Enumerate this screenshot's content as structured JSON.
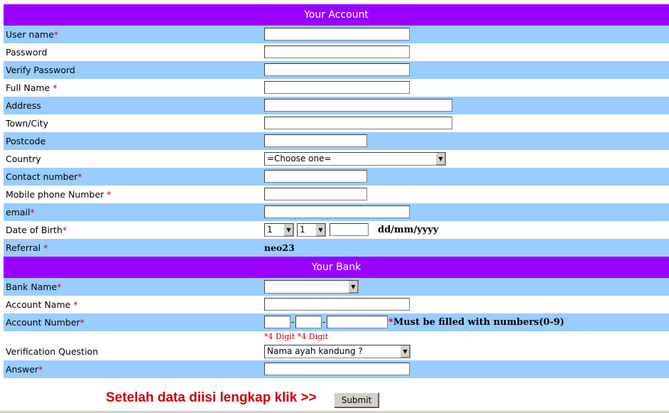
{
  "account_section": {
    "title": "Your Account"
  },
  "bank_section": {
    "title": "Your Bank"
  },
  "fields": {
    "username": {
      "label": "User name",
      "req": "*"
    },
    "password": {
      "label": "Password"
    },
    "verify_password": {
      "label": "Verify Password"
    },
    "full_name": {
      "label": "Full Name ",
      "req": "*"
    },
    "address": {
      "label": "Address"
    },
    "town": {
      "label": "Town/City"
    },
    "postcode": {
      "label": "Postcode"
    },
    "country": {
      "label": "Country",
      "selected": "=Choose one="
    },
    "contact": {
      "label": "Contact number",
      "req": "*"
    },
    "mobile": {
      "label": "Mobile phone Number ",
      "req": "*"
    },
    "email": {
      "label": "email",
      "req": "*"
    },
    "dob": {
      "label": "Date of Birth",
      "req": "*",
      "day": "1",
      "month": "1",
      "format": "dd/mm/yyyy"
    },
    "referral": {
      "label": "Referral ",
      "req": "*",
      "value": "neo23"
    },
    "bank_name": {
      "label": "Bank Name",
      "req": "*",
      "selected": ""
    },
    "account_name": {
      "label": "Account Name ",
      "req": "*"
    },
    "account_number": {
      "label": "Account Number",
      "req": "*",
      "note_star": "*",
      "note": "Must be filled with numbers(0-9)",
      "digit_hint": "*4 Digit *4 Digit",
      "sep": "-"
    },
    "verification_question": {
      "label": "Verification Question",
      "selected": "Nama ayah kandung ?"
    },
    "answer": {
      "label": "Answer",
      "req": "*"
    }
  },
  "submit": {
    "prompt": "Setelah data diisi lengkap klik  >>",
    "button": "Submit"
  }
}
